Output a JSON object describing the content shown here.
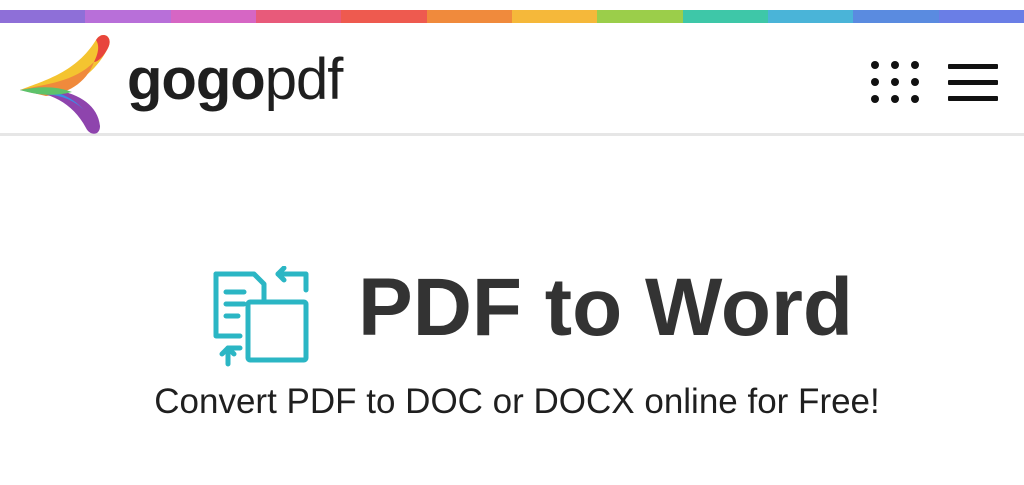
{
  "brand": {
    "name_bold": "gogo",
    "name_light": "pdf",
    "rainbow_colors": [
      "#8e6fd8",
      "#b86fd9",
      "#d666c4",
      "#e85a7a",
      "#ee5a4f",
      "#f08a3c",
      "#f5b83a",
      "#9bce4a",
      "#3ec7a8",
      "#4ab4d8",
      "#5a8be0",
      "#6a7ee6"
    ]
  },
  "header": {
    "apps_icon": "apps-grid-icon",
    "menu_icon": "hamburger-menu-icon"
  },
  "hero": {
    "icon": "pdf-to-word-convert-icon",
    "icon_color": "#2bb6c4",
    "title": "PDF to Word",
    "subtitle": "Convert PDF to DOC or DOCX online for Free!"
  }
}
